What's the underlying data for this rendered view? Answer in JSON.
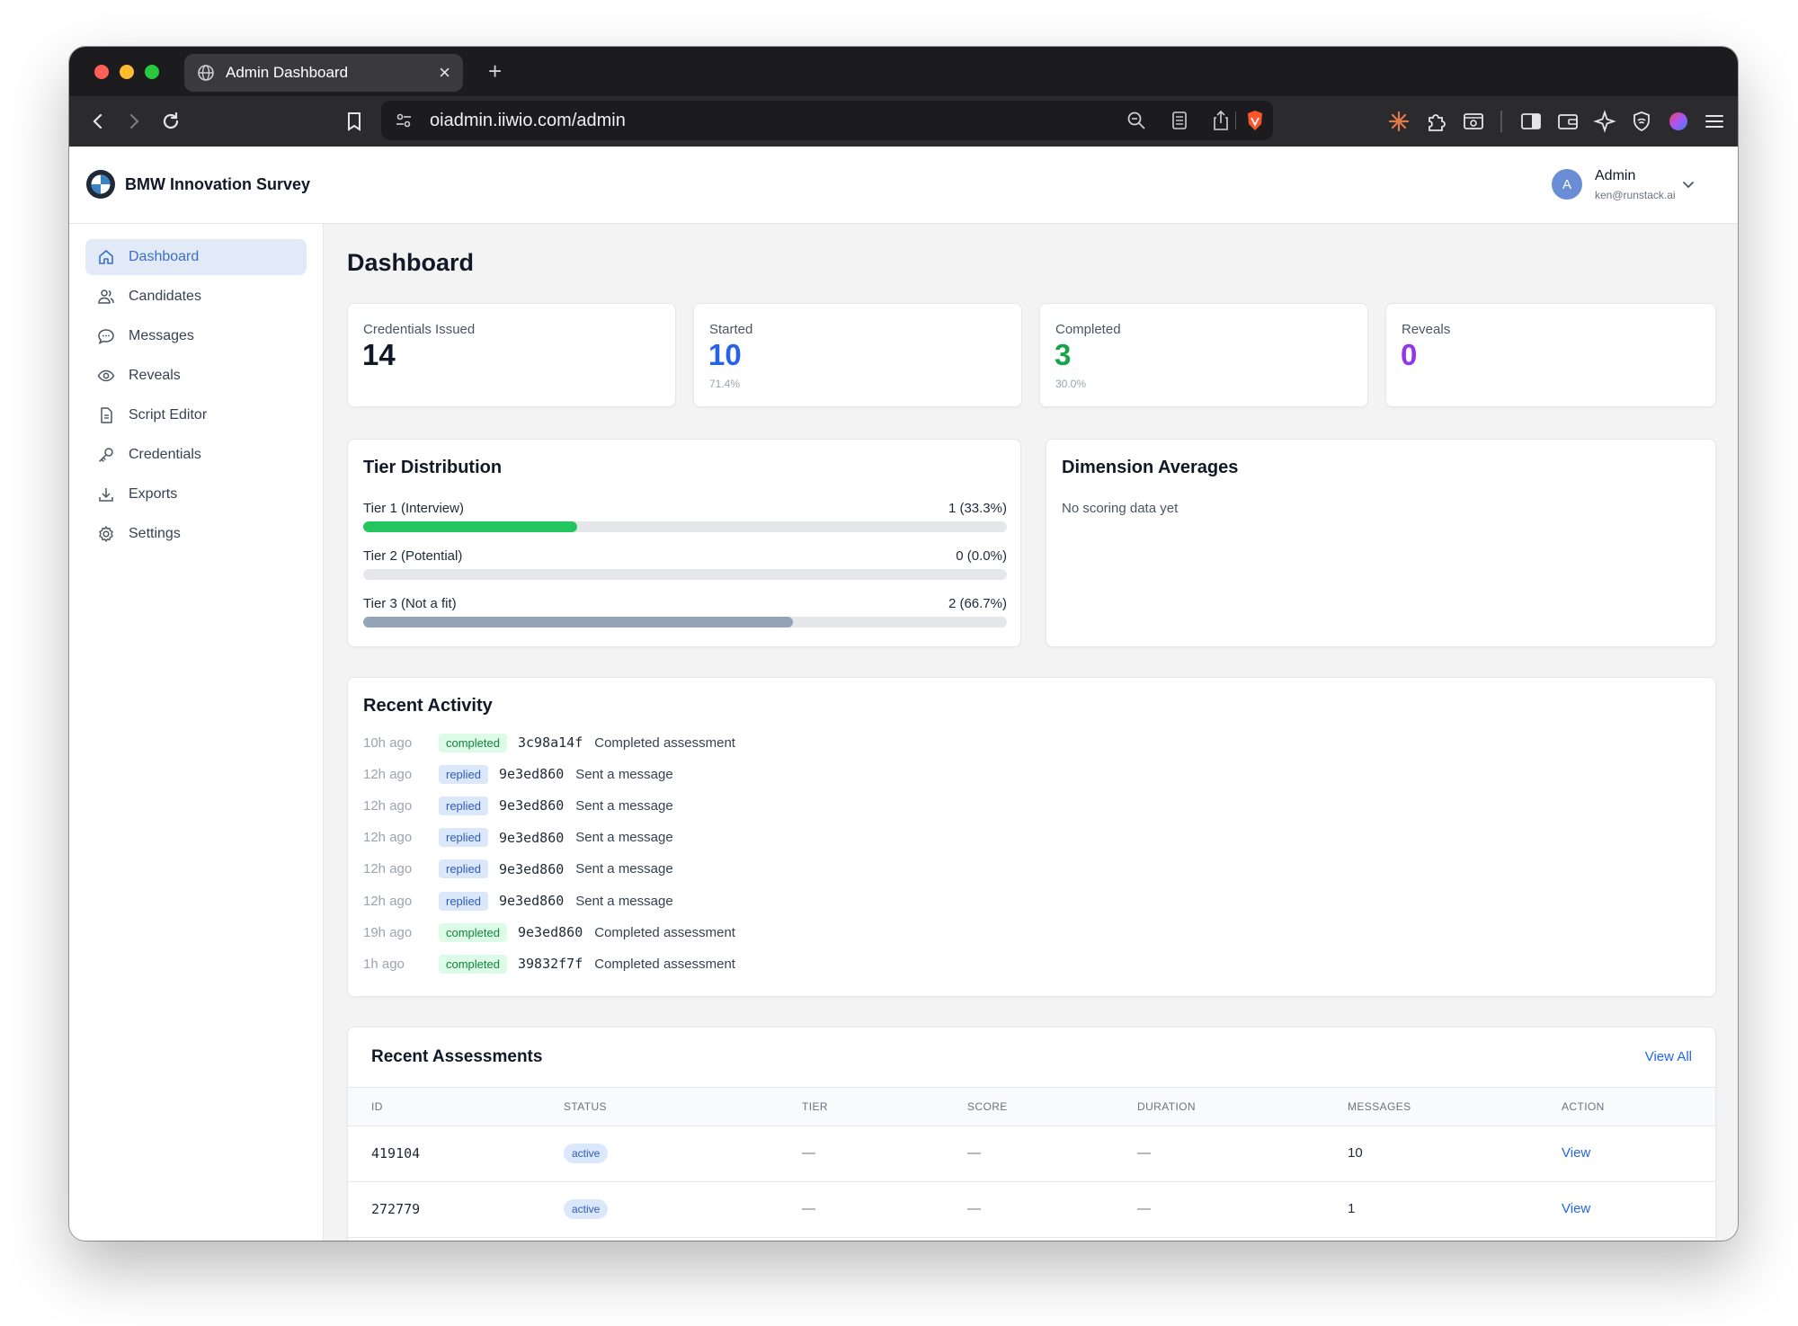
{
  "browser": {
    "tab_title": "Admin Dashboard",
    "url": "oiadmin.iiwio.com/admin"
  },
  "app": {
    "brand_name": "BMW Innovation Survey",
    "user": {
      "name": "Admin",
      "email": "ken@runstack.ai",
      "initial": "A"
    }
  },
  "sidebar": {
    "items": [
      {
        "label": "Dashboard",
        "icon": "home-icon",
        "active": true
      },
      {
        "label": "Candidates",
        "icon": "users-icon"
      },
      {
        "label": "Messages",
        "icon": "chat-icon"
      },
      {
        "label": "Reveals",
        "icon": "eye-icon"
      },
      {
        "label": "Script Editor",
        "icon": "document-icon"
      },
      {
        "label": "Credentials",
        "icon": "key-icon"
      },
      {
        "label": "Exports",
        "icon": "download-icon"
      },
      {
        "label": "Settings",
        "icon": "gear-icon"
      }
    ]
  },
  "page": {
    "title": "Dashboard"
  },
  "stats": [
    {
      "label": "Credentials Issued",
      "value": "14",
      "sub": "",
      "color": "#111827"
    },
    {
      "label": "Started",
      "value": "10",
      "sub": "71.4%",
      "color": "#2563eb"
    },
    {
      "label": "Completed",
      "value": "3",
      "sub": "30.0%",
      "color": "#16a34a"
    },
    {
      "label": "Reveals",
      "value": "0",
      "sub": "",
      "color": "#9333ea"
    }
  ],
  "tier_distribution": {
    "title": "Tier Distribution",
    "tiers": [
      {
        "label": "Tier 1 (Interview)",
        "value": "1 (33.3%)",
        "fraction": 0.333,
        "color": "#22c55e"
      },
      {
        "label": "Tier 2 (Potential)",
        "value": "0 (0.0%)",
        "fraction": 0.0,
        "color": "#9ca3af"
      },
      {
        "label": "Tier 3 (Not a fit)",
        "value": "2 (66.7%)",
        "fraction": 0.667,
        "color": "#94a3b8"
      }
    ]
  },
  "dimension_averages": {
    "title": "Dimension Averages",
    "empty_text": "No scoring data yet"
  },
  "recent_activity": {
    "title": "Recent Activity",
    "items": [
      {
        "time": "10h ago",
        "badge": "completed",
        "id": "3c98a14f",
        "desc": "Completed assessment"
      },
      {
        "time": "12h ago",
        "badge": "replied",
        "id": "9e3ed860",
        "desc": "Sent a message"
      },
      {
        "time": "12h ago",
        "badge": "replied",
        "id": "9e3ed860",
        "desc": "Sent a message"
      },
      {
        "time": "12h ago",
        "badge": "replied",
        "id": "9e3ed860",
        "desc": "Sent a message"
      },
      {
        "time": "12h ago",
        "badge": "replied",
        "id": "9e3ed860",
        "desc": "Sent a message"
      },
      {
        "time": "12h ago",
        "badge": "replied",
        "id": "9e3ed860",
        "desc": "Sent a message"
      },
      {
        "time": "19h ago",
        "badge": "completed",
        "id": "9e3ed860",
        "desc": "Completed assessment"
      },
      {
        "time": "1h ago",
        "badge": "completed",
        "id": "39832f7f",
        "desc": "Completed assessment"
      }
    ]
  },
  "recent_assessments": {
    "title": "Recent Assessments",
    "view_all": "View All",
    "columns": [
      "ID",
      "STATUS",
      "TIER",
      "SCORE",
      "DURATION",
      "MESSAGES",
      "ACTION"
    ],
    "rows": [
      {
        "id": "419104",
        "status": "active",
        "tier": "—",
        "score": "—",
        "duration": "—",
        "messages": "10",
        "action": "View"
      },
      {
        "id": "272779",
        "status": "active",
        "tier": "—",
        "score": "—",
        "duration": "—",
        "messages": "1",
        "action": "View"
      }
    ]
  }
}
